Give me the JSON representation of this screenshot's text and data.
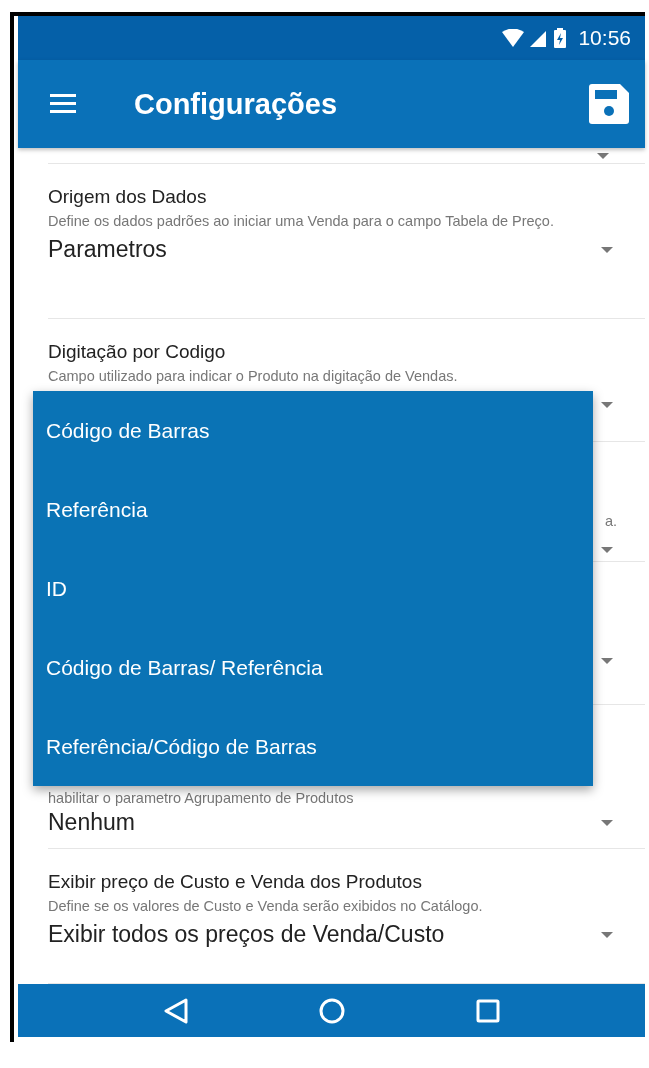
{
  "status_bar": {
    "time": "10:56"
  },
  "app_bar": {
    "title": "Configurações"
  },
  "settings": [
    {
      "title": "Origem dos Dados",
      "description": "Define os dados padrões ao iniciar uma Venda para o campo Tabela de Preço.",
      "value": "Parametros",
      "dropdown": true
    },
    {
      "title": "Digitação por Codigo",
      "description": "Campo utilizado para indicar o Produto na digitação de Vendas.",
      "dropdown": true
    },
    {
      "description": "a.",
      "dropdown": true
    },
    {
      "dropdown": true
    },
    {
      "description": "habilitar o parametro Agrupamento de Produtos",
      "value": "Nenhum",
      "dropdown": true
    },
    {
      "title": "Exibir preço de Custo e Venda dos Produtos",
      "description": "Define se os valores de Custo e Venda serão exibidos no Catálogo.",
      "value": "Exibir todos os preços de Venda/Custo",
      "dropdown": true
    }
  ],
  "dropdown_menu": [
    {
      "label": "Código de Barras",
      "selected": false
    },
    {
      "label": "Referência",
      "selected": false
    },
    {
      "label": "ID",
      "selected": false
    },
    {
      "label": "Código de Barras/ Referência",
      "selected": false
    },
    {
      "label": "Referência/Código de Barras",
      "selected": false
    }
  ]
}
